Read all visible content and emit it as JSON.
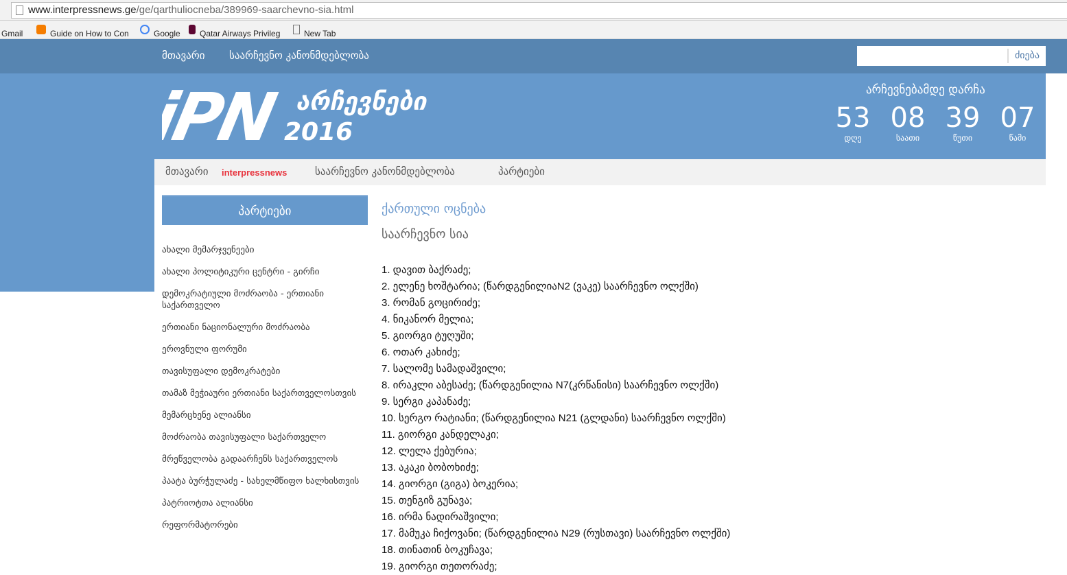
{
  "browser": {
    "url_host": "www.interpressnews.ge",
    "url_path": "/ge/qarthuliocneba/389969-saarchevno-sia.html",
    "bookmarks": [
      "Gmail",
      "Guide on How to Con",
      "Google",
      "Qatar Airways Privileg",
      "New Tab"
    ]
  },
  "topnav": {
    "items": [
      "მთავარი",
      "საარჩევნო კანონმდებლობა"
    ],
    "search_button": "ძიება",
    "search_placeholder": ""
  },
  "logo": {
    "text": "IPN",
    "subtitle": "არჩევნები",
    "year": "2016"
  },
  "countdown": {
    "title": "არჩევნებამდე დარჩა",
    "units": [
      {
        "value": "53",
        "label": "დღე"
      },
      {
        "value": "08",
        "label": "საათი"
      },
      {
        "value": "39",
        "label": "წუთი"
      },
      {
        "value": "07",
        "label": "წამი"
      }
    ]
  },
  "subnav": {
    "home": "მთავარი",
    "brand": "interpressnews",
    "law": "საარჩევნო კანონმდებლობა",
    "parties": "პარტიები"
  },
  "sidebar": {
    "title": "პარტიები",
    "items": [
      "ახალი მემარჯვენეები",
      "ახალი პოლიტიკური ცენტრი - გირჩი",
      "დემოკრატიული მოძრაობა - ერთიანი საქართველო",
      "ერთიანი ნაციონალური მოძრაობა",
      "ეროვნული ფორუმი",
      "თავისუფალი დემოკრატები",
      "თამაზ მეჭიაური ერთიანი საქართველოსთვის",
      "მემარცხენე ალიანსი",
      "მოძრაობა თავისუფალი საქართველო",
      "მრეწველობა გადაარჩენს საქართველოს",
      "პაატა ბურჭულაძე - სახელმწიფო ხალხისთვის",
      "პატრიოტთა ალიანსი",
      "რეფორმატორები"
    ]
  },
  "main": {
    "party": "ქართული ოცნება",
    "heading": "საარჩევნო სია",
    "list": [
      "1. დავით ბაქრაძე;",
      "2. ელენე ხოშტარია; (წარდგენილიაN2 (ვაკე) საარჩევნო ოლქში)",
      "3. რომან გოცირიძე;",
      "4. ნიკანორ მელია;",
      "5. გიორგი ტუღუში;",
      "6. ოთარ კახიძე;",
      "7. სალომე სამადაშვილი;",
      "8. ირაკლი აბესაძე; (წარდგენილია N7(კრწანისი) საარჩევნო ოლქში)",
      "9. სერგი კაპანაძე;",
      "10. სერგო რატიანი; (წარდგენილია N21 (გლდანი) საარჩევნო ოლქში)",
      "11. გიორგი კანდელაკი;",
      "12. ლელა ქებურია;",
      "13. აკაკი ბობოხიძე;",
      "14. გიორგი (გიგა) ბოკერია;",
      "15. თენგიზ გუნავა;",
      "16. ირმა ნადირაშვილი;",
      "17. მამუკა ჩიქოვანი; (წარდგენილია N29 (რუსთავი) საარჩევნო ოლქში)",
      "18. თინათინ ბოკუჩავა;",
      "19. გიორგი თეთორაძე;"
    ]
  }
}
